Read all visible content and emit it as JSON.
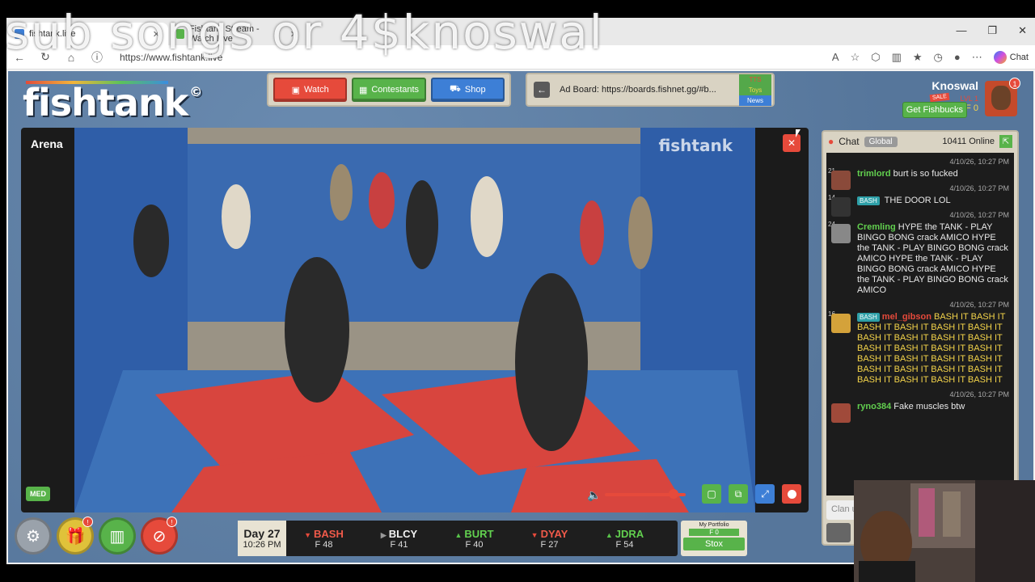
{
  "overlay": {
    "text": "sub songs or 4$knoswal"
  },
  "browser": {
    "tabs": [
      {
        "label": "fishtank.live",
        "active": true
      },
      {
        "label": "Fishtank Stream - Watch Live",
        "active": false
      }
    ],
    "url": "https://www.fishtank.live",
    "chat_label": "Chat"
  },
  "site": {
    "logo": "fishtank",
    "nav": {
      "watch": "Watch",
      "contestants": "Contestants",
      "shop": "Shop"
    },
    "adboard": {
      "text": "Ad Board: https://boards.fishnet.gg/#b...",
      "tabs": [
        "TTS",
        "Toys",
        "News"
      ]
    },
    "user": {
      "name": "Knoswal",
      "level": "LVL 1",
      "balance": "F 0",
      "sale": "SALE",
      "fishbucks_button": "Get Fishbucks",
      "notifications": "1"
    }
  },
  "video": {
    "room": "Arena",
    "watermark": "fishtank",
    "quality": "MED",
    "volume": 0.85
  },
  "bottom": {
    "icon_badges": {
      "gift": "!",
      "ban": "!"
    },
    "day": "Day 27",
    "time": "10:26 PM",
    "stocks": [
      {
        "symbol": "BASH",
        "trend": "down",
        "value": "F 48"
      },
      {
        "symbol": "BLCY",
        "trend": "flat",
        "value": "F 41"
      },
      {
        "symbol": "BURT",
        "trend": "up",
        "value": "F 40"
      },
      {
        "symbol": "DYAY",
        "trend": "down",
        "value": "F 27"
      },
      {
        "symbol": "JDRA",
        "trend": "up",
        "value": "F 54"
      }
    ],
    "portfolio": {
      "label": "My Portfolio",
      "value": "F 0",
      "button": "Stox"
    }
  },
  "chat": {
    "title": "Chat",
    "channel": "Global",
    "online": "10411 Online",
    "input_placeholder": "Clan u",
    "messages": [
      {
        "ts": "4/10/26, 10:27 PM",
        "level": "21",
        "user": "trimlord",
        "badge": "",
        "text": "burt is so fucked"
      },
      {
        "ts": "4/10/26, 10:27 PM",
        "level": "14",
        "user": "",
        "badge": "BASH",
        "text": "THE DOOR LOL"
      },
      {
        "ts": "4/10/26, 10:27 PM",
        "level": "24",
        "user": "Cremling",
        "badge": "",
        "text": "HYPE the TANK - PLAY BINGO BONG crack AMICO HYPE the TANK - PLAY BINGO BONG crack AMICO HYPE the TANK - PLAY BINGO BONG crack AMICO HYPE the TANK - PLAY BINGO BONG crack AMICO"
      },
      {
        "ts": "4/10/26, 10:27 PM",
        "level": "16",
        "user": "mel_gibson",
        "badge": "BASH",
        "text": "BASH IT BASH IT BASH IT BASH IT BASH IT BASH IT BASH IT BASH IT BASH IT BASH IT BASH IT BASH IT BASH IT BASH IT BASH IT BASH IT BASH IT BASH IT BASH IT BASH IT BASH IT BASH IT BASH IT BASH IT BASH IT BASH IT"
      },
      {
        "ts": "4/10/26, 10:27 PM",
        "level": "",
        "user": "ryno384",
        "badge": "",
        "text": "Fake muscles btw"
      }
    ]
  }
}
